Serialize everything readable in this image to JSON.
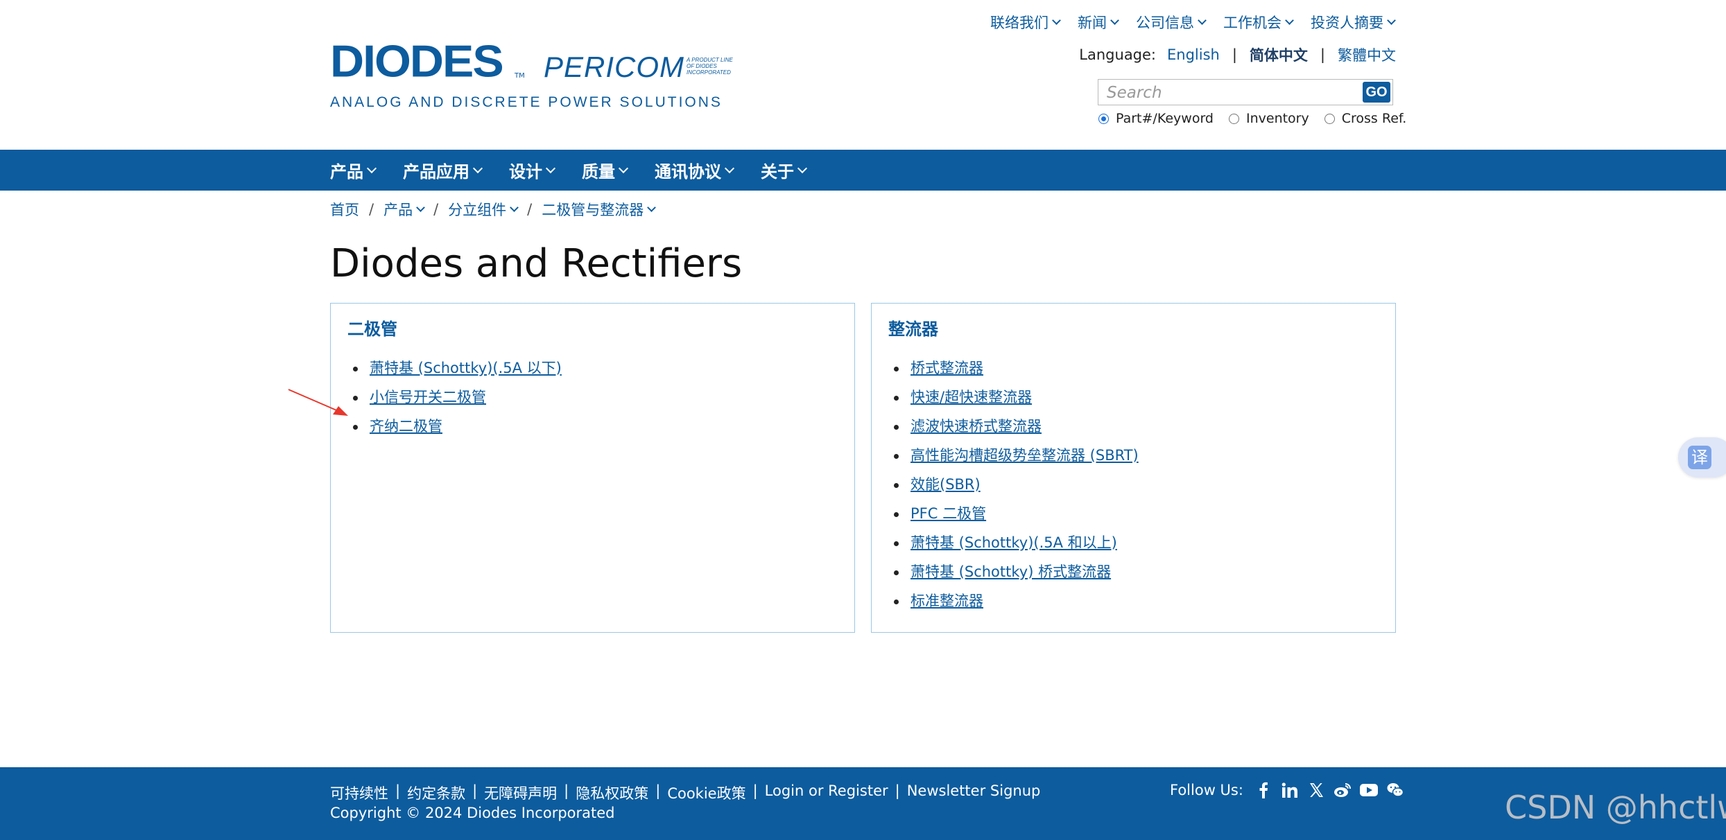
{
  "brand": {
    "logo_text": "DIODES",
    "trademark": "TM",
    "sub_brand": "PERICOM",
    "sub_brand_tag": "A PRODUCT LINE\nOF DIODES\nINCORPORATED",
    "tagline": "ANALOG AND DISCRETE POWER SOLUTIONS"
  },
  "topnav": {
    "items": [
      {
        "label": "联络我们"
      },
      {
        "label": "新闻"
      },
      {
        "label": "公司信息"
      },
      {
        "label": "工作机会"
      },
      {
        "label": "投资人摘要"
      }
    ]
  },
  "language": {
    "label": "Language:",
    "english": "English",
    "simplified": "简体中文",
    "traditional": "繁體中文",
    "separator": "|"
  },
  "search": {
    "placeholder": "Search",
    "go_label": "GO",
    "options": [
      {
        "label": "Part#/Keyword",
        "selected": true
      },
      {
        "label": "Inventory",
        "selected": false
      },
      {
        "label": "Cross Ref.",
        "selected": false
      }
    ]
  },
  "mainnav": {
    "items": [
      {
        "label": "产品"
      },
      {
        "label": "产品应用"
      },
      {
        "label": "设计"
      },
      {
        "label": "质量"
      },
      {
        "label": "通讯协议"
      },
      {
        "label": "关于"
      }
    ]
  },
  "breadcrumb": {
    "items": [
      {
        "label": "首页"
      },
      {
        "label": "产品"
      },
      {
        "label": "分立组件"
      },
      {
        "label": "二极管与整流器"
      }
    ],
    "separator": "/"
  },
  "page": {
    "title": "Diodes and Rectifiers"
  },
  "panels": {
    "left": {
      "heading": "二极管",
      "items": [
        {
          "label": "萧特基 (Schottky)(.5A 以下)"
        },
        {
          "label": "小信号开关二极管"
        },
        {
          "label": "齐纳二极管"
        }
      ]
    },
    "right": {
      "heading": "整流器",
      "items": [
        {
          "label": "桥式整流器"
        },
        {
          "label": "快速/超快速整流器"
        },
        {
          "label": "滤波快速桥式整流器"
        },
        {
          "label": "高性能沟槽超级势垒整流器 (SBRT)"
        },
        {
          "label": "效能(SBR)"
        },
        {
          "label": "PFC 二极管"
        },
        {
          "label": "萧特基 (Schottky)(.5A 和以上)"
        },
        {
          "label": "萧特基 (Schottky) 桥式整流器"
        },
        {
          "label": "标准整流器"
        }
      ]
    }
  },
  "translate": {
    "label": "译"
  },
  "footer": {
    "links": [
      {
        "label": "可持续性"
      },
      {
        "label": "约定条款"
      },
      {
        "label": "无障碍声明"
      },
      {
        "label": "隐私权政策"
      },
      {
        "label": "Cookie政策"
      },
      {
        "label": "Login or Register"
      },
      {
        "label": "Newsletter Signup"
      }
    ],
    "separator": "|",
    "copyright": "Copyright © 2024 Diodes Incorporated",
    "follow_label": "Follow Us:",
    "social_icons": [
      "facebook-icon",
      "linkedin-icon",
      "x-icon",
      "weibo-icon",
      "youtube-icon",
      "wechat-icon"
    ]
  },
  "watermark": "CSDN @hhctlw",
  "colors": {
    "brand_blue": "#0d5c9e",
    "panel_border": "#9cc6e4",
    "annotation_red": "#e8372c"
  }
}
